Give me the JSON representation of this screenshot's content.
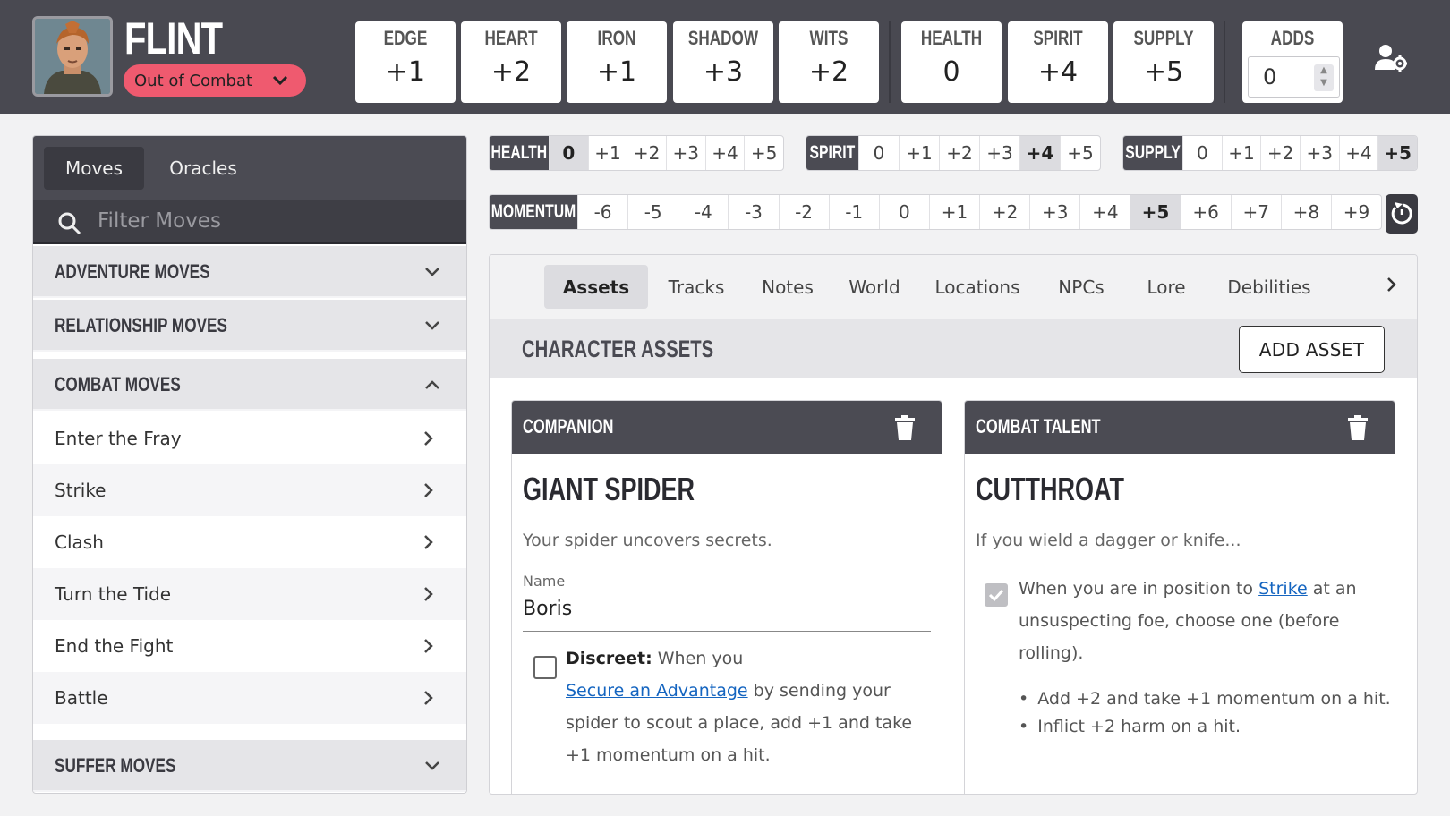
{
  "character": {
    "name": "FLINT",
    "combat_status": "Out of Combat"
  },
  "stats": [
    {
      "label": "EDGE",
      "value": "+1"
    },
    {
      "label": "HEART",
      "value": "+2"
    },
    {
      "label": "IRON",
      "value": "+1"
    },
    {
      "label": "SHADOW",
      "value": "+3"
    },
    {
      "label": "WITS",
      "value": "+2"
    }
  ],
  "meters": [
    {
      "label": "HEALTH",
      "value": "0"
    },
    {
      "label": "SPIRIT",
      "value": "+4"
    },
    {
      "label": "SUPPLY",
      "value": "+5"
    }
  ],
  "adds": {
    "label": "ADDS",
    "value": "0"
  },
  "sidebar": {
    "tabs": [
      "Moves",
      "Oracles"
    ],
    "active_tab": "Moves",
    "filter_placeholder": "Filter Moves",
    "categories": [
      {
        "label": "ADVENTURE MOVES",
        "expanded": false
      },
      {
        "label": "RELATIONSHIP MOVES",
        "expanded": false
      },
      {
        "label": "COMBAT MOVES",
        "expanded": true
      },
      {
        "label": "SUFFER MOVES",
        "expanded": false
      }
    ],
    "combat_moves": [
      "Enter the Fray",
      "Strike",
      "Clash",
      "Turn the Tide",
      "End the Fight",
      "Battle"
    ]
  },
  "trackers": {
    "health": {
      "label": "HEALTH",
      "values": [
        "0",
        "+1",
        "+2",
        "+3",
        "+4",
        "+5"
      ],
      "selected": "0"
    },
    "spirit": {
      "label": "SPIRIT",
      "values": [
        "0",
        "+1",
        "+2",
        "+3",
        "+4",
        "+5"
      ],
      "selected": "+4"
    },
    "supply": {
      "label": "SUPPLY",
      "values": [
        "0",
        "+1",
        "+2",
        "+3",
        "+4",
        "+5"
      ],
      "selected": "+5"
    },
    "momentum": {
      "label": "MOMENTUM",
      "values": [
        "-6",
        "-5",
        "-4",
        "-3",
        "-2",
        "-1",
        "0",
        "+1",
        "+2",
        "+3",
        "+4",
        "+5",
        "+6",
        "+7",
        "+8",
        "+9"
      ],
      "selected": "+5"
    }
  },
  "main_tabs": [
    "Assets",
    "Tracks",
    "Notes",
    "World",
    "Locations",
    "NPCs",
    "Lore",
    "Debilities"
  ],
  "active_main_tab": "Assets",
  "assets_section": {
    "title": "CHARACTER ASSETS",
    "add_button": "ADD ASSET"
  },
  "assets": [
    {
      "type": "COMPANION",
      "name": "GIANT SPIDER",
      "description": "Your spider uncovers secrets.",
      "field_label": "Name",
      "field_value": "Boris",
      "ability": {
        "checked": false,
        "title": "Discreet:",
        "text_before": "When you",
        "link": "Secure an Advantage",
        "text_after": "by sending your spider to scout a place, add +1 and take +1 momentum on a hit."
      }
    },
    {
      "type": "COMBAT TALENT",
      "name": "CUTTHROAT",
      "description": "If you wield a dagger or knife...",
      "ability": {
        "checked": true,
        "text_before": "When you are in position to",
        "link": "Strike",
        "text_after": "at an unsuspecting foe, choose one (before rolling)."
      },
      "options": [
        "Add +2 and take +1 momentum on a hit.",
        "Inflict +2 harm on a hit."
      ]
    }
  ],
  "colors": {
    "header_bg": "#494951",
    "status_pill": "#ef5a6f",
    "link": "#1565c0",
    "selected_cell": "#dcdce0"
  }
}
